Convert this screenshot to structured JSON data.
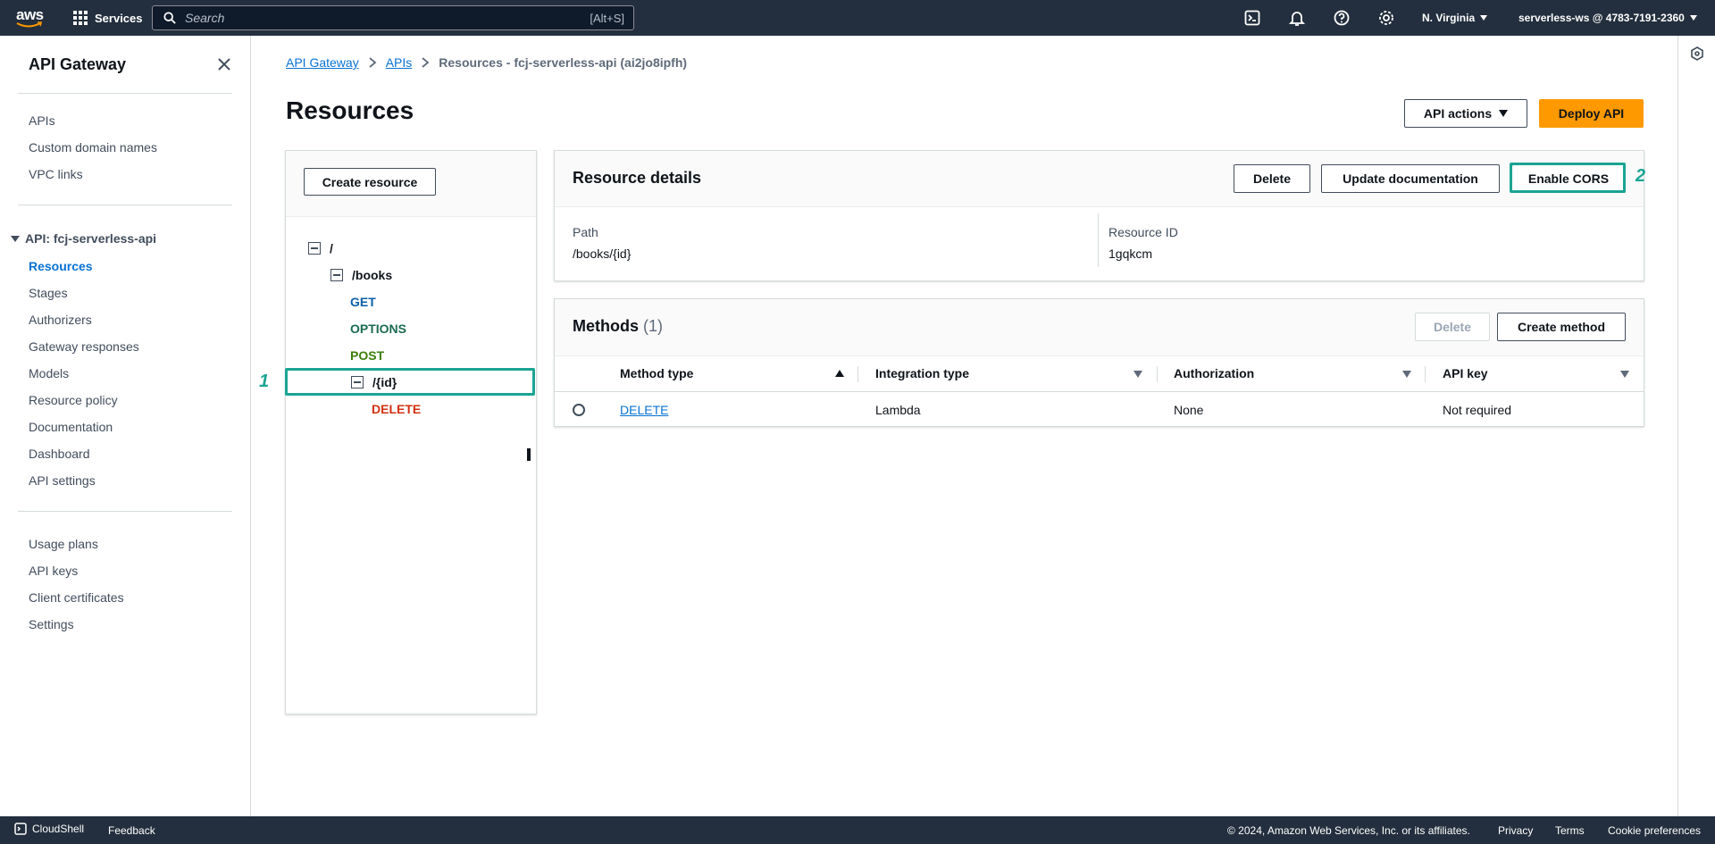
{
  "topnav": {
    "logo_text": "aws",
    "services_label": "Services",
    "search_placeholder": "Search",
    "search_shortcut": "[Alt+S]",
    "icons": [
      "cloudshell-icon",
      "bell-icon",
      "help-icon",
      "settings-icon"
    ],
    "region": "N. Virginia",
    "account": "serverless-ws @ 4783-7191-2360"
  },
  "sidebar": {
    "title": "API Gateway",
    "top_items": [
      {
        "label": "APIs"
      },
      {
        "label": "Custom domain names"
      },
      {
        "label": "VPC links"
      }
    ],
    "api_section": "API: fcj-serverless-api",
    "api_items": [
      {
        "label": "Resources",
        "active": true
      },
      {
        "label": "Stages"
      },
      {
        "label": "Authorizers"
      },
      {
        "label": "Gateway responses"
      },
      {
        "label": "Models"
      },
      {
        "label": "Resource policy"
      },
      {
        "label": "Documentation"
      },
      {
        "label": "Dashboard"
      },
      {
        "label": "API settings"
      }
    ],
    "bottom_items": [
      {
        "label": "Usage plans"
      },
      {
        "label": "API keys"
      },
      {
        "label": "Client certificates"
      },
      {
        "label": "Settings"
      }
    ]
  },
  "breadcrumb": {
    "items": [
      "API Gateway",
      "APIs"
    ],
    "current": "Resources - fcj-serverless-api (ai2jo8ipfh)"
  },
  "page": {
    "title": "Resources",
    "api_actions_label": "API actions",
    "deploy_label": "Deploy API"
  },
  "tree": {
    "create_resource_label": "Create resource",
    "root": "/",
    "books": "/books",
    "books_methods": [
      {
        "label": "GET",
        "color": "#0b5ea8"
      },
      {
        "label": "OPTIONS",
        "color": "#1d6b52"
      },
      {
        "label": "POST",
        "color": "#3d7d0b"
      }
    ],
    "id_resource": "/{id}",
    "id_methods": [
      {
        "label": "DELETE",
        "color": "#d13212"
      }
    ]
  },
  "callouts": {
    "one": "1",
    "two": "2",
    "color": "#1ba493"
  },
  "resource_details": {
    "title": "Resource details",
    "delete_label": "Delete",
    "update_doc_label": "Update documentation",
    "enable_cors_label": "Enable CORS",
    "path_label": "Path",
    "path_value": "/books/{id}",
    "resource_id_label": "Resource ID",
    "resource_id_value": "1gqkcm"
  },
  "methods": {
    "title": "Methods",
    "count": "(1)",
    "delete_label": "Delete",
    "create_label": "Create method",
    "columns": [
      "Method type",
      "Integration type",
      "Authorization",
      "API key"
    ],
    "rows": [
      {
        "method": "DELETE",
        "integration": "Lambda",
        "authorization": "None",
        "api_key": "Not required"
      }
    ]
  },
  "footer": {
    "cloudshell": "CloudShell",
    "feedback": "Feedback",
    "copyright": "© 2024, Amazon Web Services, Inc. or its affiliates.",
    "privacy": "Privacy",
    "terms": "Terms",
    "cookies": "Cookie preferences"
  }
}
